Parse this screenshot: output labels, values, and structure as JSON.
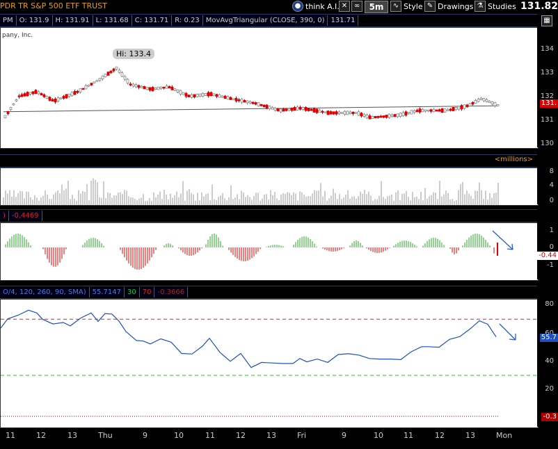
{
  "header": {
    "symbol_title": "PDR TR S&P 500 ETF TRUST",
    "think_label": "think A.I.",
    "timeframe": "5m",
    "style_label": "Style",
    "drawings_label": "Drawings",
    "studies_label": "Studies",
    "last_price": "131.82"
  },
  "price_info": {
    "time": "PM",
    "open": "O: 131.9",
    "high": "H: 131.91",
    "low": "L: 131.68",
    "close": "C: 131.71",
    "range": "R: 0.23",
    "study": "MovAvgTriangular (CLOSE, 390, 0)",
    "study_value": "131.71"
  },
  "price_panel": {
    "company": "pany, Inc.",
    "hi_label": "Hi: 133.4",
    "y_ticks": [
      "134",
      "133",
      "132",
      "131",
      "130"
    ],
    "price_tag": "131."
  },
  "volume_panel": {
    "units": "<millions>",
    "y_ticks": [
      "8",
      "4",
      "0"
    ]
  },
  "osc_panel": {
    "header_value": "-0.4469",
    "y_ticks": [
      "1",
      "0",
      "-1"
    ],
    "tag": "-0.44"
  },
  "rsi_panel": {
    "header_params": "O/4, 120, 260, 90, SMA)",
    "value": "55.7147",
    "oversold": "30",
    "overbought": "70",
    "extra": "-0.3666",
    "y_ticks": [
      "80",
      "60",
      "40",
      "20"
    ],
    "tag": "55.7",
    "bottom_tag": "-0.3"
  },
  "x_axis": {
    "labels": [
      "11",
      "12",
      "13",
      "Thu",
      "9",
      "10",
      "11",
      "12",
      "13",
      "Fri",
      "9",
      "10",
      "11",
      "12",
      "13",
      "Mon"
    ]
  },
  "colors": {
    "up": "#888888",
    "down": "#dd0000",
    "osc_pos": "#22aa22",
    "rsi_line": "#1f4fbf",
    "ob_line": "#dd2222",
    "os_line": "#22cc22",
    "arrow": "#2a5cc8"
  }
}
